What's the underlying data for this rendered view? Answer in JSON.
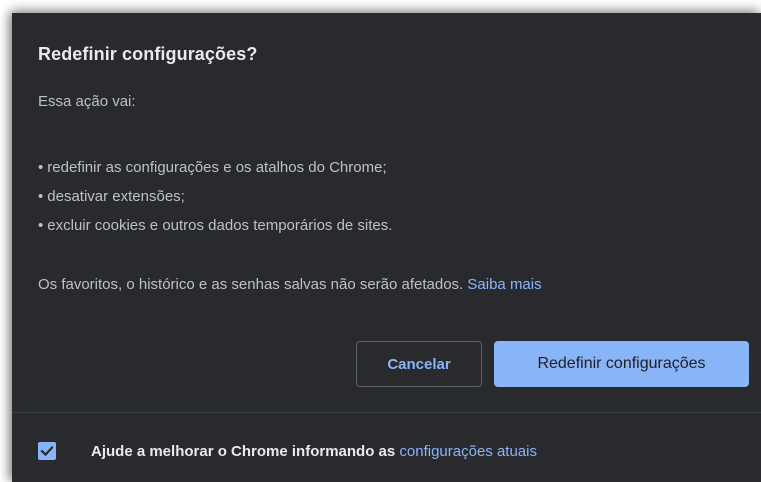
{
  "dialog": {
    "title": "Redefinir configurações?",
    "intro": "Essa ação vai:",
    "bullets": [
      "redefinir as configurações e os atalhos do Chrome;",
      "desativar extensões;",
      "excluir cookies e outros dados temporários de sites."
    ],
    "bullet_glyph": "•",
    "footnote_text": "Os favoritos, o histórico e as senhas salvas não serão afetados.",
    "footnote_link": "Saiba mais",
    "cancel_label": "Cancelar",
    "reset_label": "Redefinir configurações",
    "checkbox": {
      "checked": true,
      "label_text": "Ajude a melhorar o Chrome informando as",
      "label_link": "configurações atuais",
      "icon": "checkmark-icon"
    }
  },
  "colors": {
    "dialog_background": "#292a2d",
    "title_text": "#e8eaed",
    "body_text": "#bdc1c6",
    "link": "#8ab4f8",
    "primary_button": "#8ab4f8",
    "button_border": "#5f6368",
    "divider": "#3c4043"
  }
}
